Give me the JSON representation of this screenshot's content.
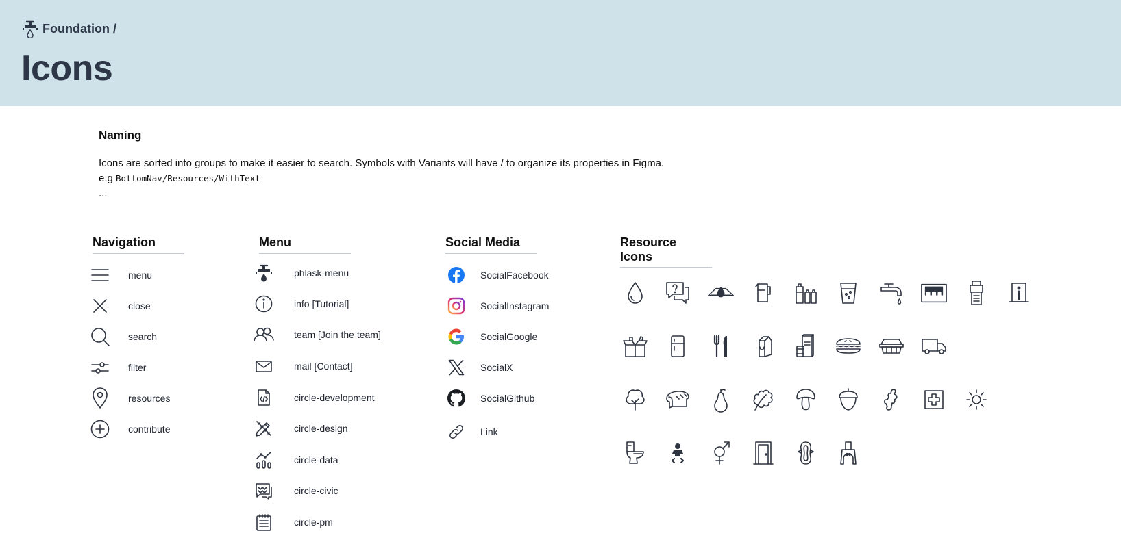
{
  "header": {
    "breadcrumb": "Foundation /",
    "title": "Icons"
  },
  "naming": {
    "heading": "Naming",
    "description": "Icons are sorted into groups to make it easier to search. Symbols with Variants will have / to organize its properties in Figma.",
    "example_prefix": "e.g",
    "example_code": "BottomNav/Resources/WithText",
    "ellipsis": "..."
  },
  "navigation": {
    "title": "Navigation",
    "items": [
      {
        "label": "menu",
        "icon": "hamburger-icon"
      },
      {
        "label": "close",
        "icon": "close-icon"
      },
      {
        "label": "search",
        "icon": "search-icon"
      },
      {
        "label": "filter",
        "icon": "filter-icon"
      },
      {
        "label": "resources",
        "icon": "location-pin-icon"
      },
      {
        "label": "contribute",
        "icon": "plus-circle-icon"
      }
    ]
  },
  "menu": {
    "title": "Menu",
    "items": [
      {
        "label": "phlask-menu",
        "icon": "faucet-icon"
      },
      {
        "label": "info [Tutorial]",
        "icon": "info-icon"
      },
      {
        "label": "team [Join the team]",
        "icon": "team-icon"
      },
      {
        "label": "mail [Contact]",
        "icon": "mail-icon"
      },
      {
        "label": "circle-development",
        "icon": "code-file-icon"
      },
      {
        "label": "circle-design",
        "icon": "pencil-ruler-icon"
      },
      {
        "label": "circle-data",
        "icon": "data-chart-icon"
      },
      {
        "label": "circle-civic",
        "icon": "civic-chat-icon"
      },
      {
        "label": "circle-pm",
        "icon": "notepad-icon"
      }
    ]
  },
  "social": {
    "title": "Social Media",
    "items": [
      {
        "label": "SocialFacebook",
        "icon": "facebook-icon"
      },
      {
        "label": "SocialInstagram",
        "icon": "instagram-icon"
      },
      {
        "label": "SocialGoogle",
        "icon": "google-icon"
      },
      {
        "label": "SocialX",
        "icon": "x-icon"
      },
      {
        "label": "SocialGithub",
        "icon": "github-icon"
      },
      {
        "label": "Link",
        "icon": "link-icon"
      }
    ]
  },
  "resources": {
    "title": "Resource Icons"
  },
  "colors": {
    "header_bg": "#cfe2e9",
    "title_text": "#2d3748",
    "icon_stroke": "#2e3440",
    "facebook": "#1877f2"
  }
}
